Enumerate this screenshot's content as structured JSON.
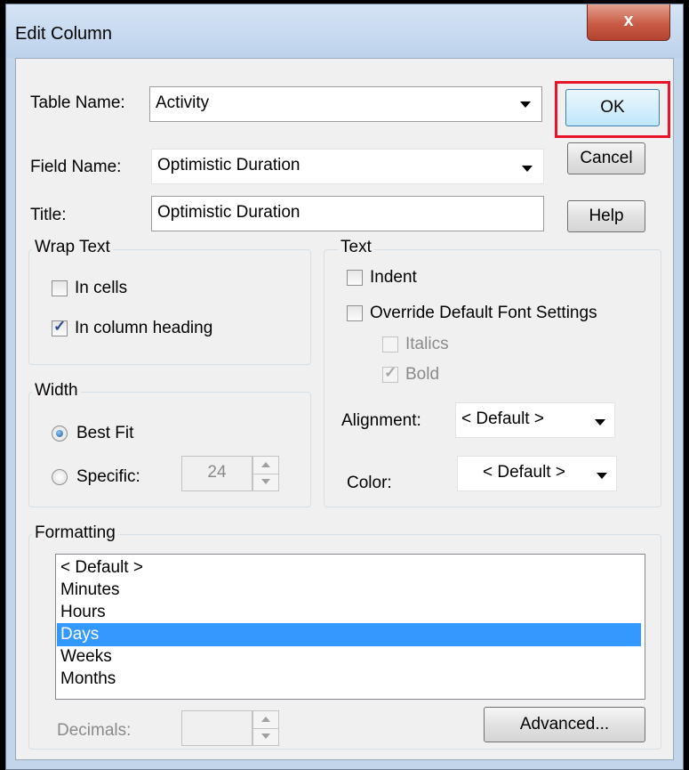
{
  "dialog": {
    "title": "Edit Column",
    "close_label": "x"
  },
  "table_name": {
    "label": "Table Name:",
    "value": "Activity"
  },
  "field_name": {
    "label": "Field Name:",
    "value": "Optimistic Duration"
  },
  "title_field": {
    "label": "Title:",
    "value": "Optimistic Duration"
  },
  "buttons": {
    "ok": "OK",
    "cancel": "Cancel",
    "help": "Help",
    "advanced": "Advanced..."
  },
  "wrap_text": {
    "legend": "Wrap Text",
    "in_cells": "In cells",
    "in_cells_checked": false,
    "in_heading": "In column heading",
    "in_heading_checked": true
  },
  "width": {
    "legend": "Width",
    "best_fit": "Best Fit",
    "specific": "Specific:",
    "selected": "best_fit",
    "specific_value": "24"
  },
  "text": {
    "legend": "Text",
    "indent": "Indent",
    "override": "Override Default Font Settings",
    "italics": "Italics",
    "bold": "Bold",
    "bold_checked": true,
    "alignment_label": "Alignment:",
    "alignment_value": "< Default >",
    "color_label": "Color:",
    "color_value": "< Default >"
  },
  "formatting": {
    "legend": "Formatting",
    "items": [
      "< Default >",
      "Minutes",
      "Hours",
      "Days",
      "Weeks",
      "Months"
    ],
    "selected": "Days",
    "decimals_label": "Decimals:"
  },
  "colors": {
    "highlight": "#e8142a",
    "selection": "#3399ff"
  }
}
